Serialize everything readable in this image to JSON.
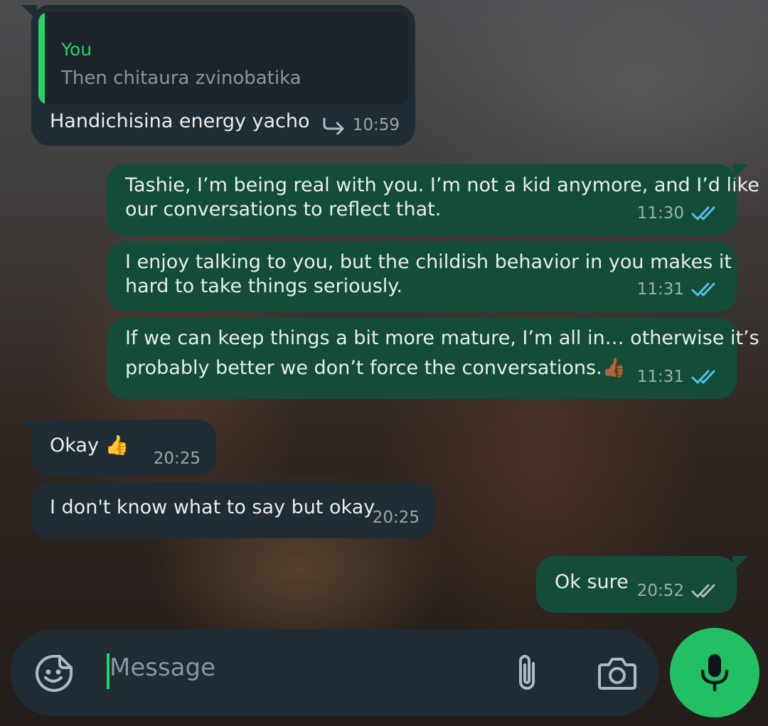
{
  "messages": [
    {
      "direction": "in",
      "quote": {
        "author": "You",
        "text": "Then chitaura zvinobatika"
      },
      "text": "Handichisina energy yacho",
      "time": "10:59",
      "forwarded_icon": "reply-arrow-icon"
    },
    {
      "direction": "out",
      "lines": [
        "Tashie, I’m being real with you. I’m not a kid anymore, and I’d like",
        "our conversations to reflect that."
      ],
      "time": "11:30",
      "status": "read"
    },
    {
      "direction": "out",
      "lines": [
        "I enjoy talking to you, but the childish behavior in you  makes it",
        "hard to take things seriously."
      ],
      "time": "11:31",
      "status": "read"
    },
    {
      "direction": "out",
      "lines": [
        "If we can keep things a bit more mature, I’m all in… otherwise it’s",
        "probably better we don’t force the conversations.👍🏾"
      ],
      "time": "11:31",
      "status": "read"
    },
    {
      "direction": "in",
      "text": "Okay 👍",
      "time": "20:25"
    },
    {
      "direction": "in",
      "text": "I don't know what to say but okay",
      "time": "20:25"
    },
    {
      "direction": "out",
      "text": "Ok sure",
      "time": "20:52",
      "status": "delivered"
    }
  ],
  "composer": {
    "placeholder": "Message",
    "icons": [
      "sticker-icon",
      "attach-icon",
      "camera-icon",
      "mic-icon"
    ]
  },
  "colors": {
    "incoming_bubble": "#202c33",
    "outgoing_bubble": "#144d37",
    "read_ticks": "#53bdeb",
    "delivered_ticks": "#aebac1",
    "accent": "#25d366",
    "mic_button": "#21c063"
  }
}
